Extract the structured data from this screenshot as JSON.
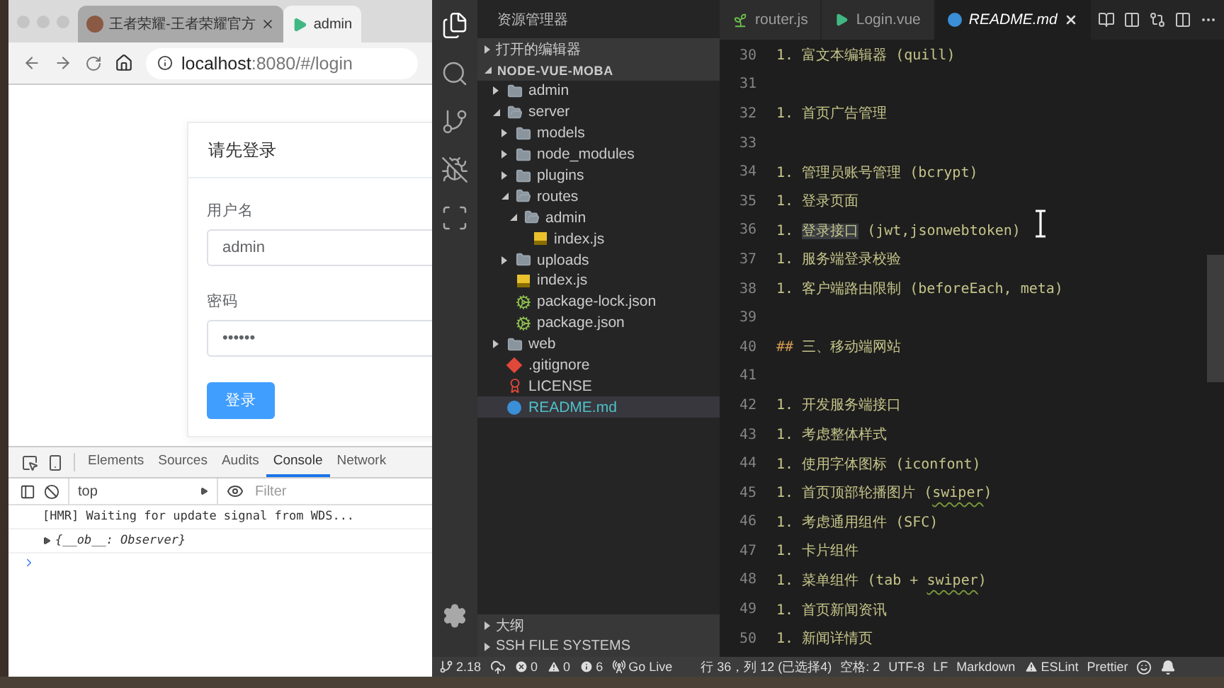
{
  "browser": {
    "tabs": [
      {
        "title": "王者荣耀-王者荣耀官方",
        "kind": "avatar",
        "selected": false
      },
      {
        "title": "admin",
        "kind": "vue",
        "selected": true
      }
    ],
    "address": "**localhost**:8080/#/login",
    "login": {
      "title": "请先登录",
      "fields": [
        {
          "label": "用户名",
          "value": "admin"
        },
        {
          "label": "密码",
          "value": "••••••"
        }
      ],
      "submit": "登录"
    },
    "devtools": {
      "tabs": [
        {
          "label": "Elements",
          "selected": false
        },
        {
          "label": "Sources",
          "selected": false
        },
        {
          "label": "Audits",
          "selected": false
        },
        {
          "label": "Console",
          "selected": true
        },
        {
          "label": "Network",
          "selected": false
        }
      ],
      "context": "top",
      "filter_placeholder": "Filter",
      "console": [
        {
          "kind": "log",
          "text": "[HMR] Waiting for update signal from WDS..."
        },
        {
          "kind": "object",
          "text": "{__ob__: Observer}",
          "expanded": false
        }
      ]
    }
  },
  "vscode": {
    "activity": [
      {
        "kind": "files",
        "selected": true
      },
      {
        "kind": "search",
        "selected": false
      },
      {
        "kind": "source-control",
        "selected": false
      },
      {
        "kind": "debug",
        "selected": false
      },
      {
        "kind": "remote",
        "selected": false
      }
    ],
    "sidebar": {
      "title": "资源管理器",
      "open_editors": {
        "label": "打开的编辑器",
        "expanded": false
      },
      "project": {
        "label": "NODE-VUE-MOBA",
        "expanded": true,
        "tree": [
          {
            "name": "admin",
            "kind": "folder",
            "expanded": false,
            "selected": false
          },
          {
            "name": "server",
            "kind": "folder",
            "expanded": true,
            "selected": false,
            "children": [
              {
                "name": "models",
                "kind": "folder",
                "expanded": false,
                "selected": false
              },
              {
                "name": "node_modules",
                "kind": "folder",
                "expanded": false,
                "selected": false
              },
              {
                "name": "plugins",
                "kind": "folder",
                "expanded": false,
                "selected": false
              },
              {
                "name": "routes",
                "kind": "folder",
                "expanded": true,
                "selected": false,
                "children": [
                  {
                    "name": "admin",
                    "kind": "folder",
                    "expanded": true,
                    "selected": false,
                    "children": [
                      {
                        "name": "index.js",
                        "kind": "js",
                        "selected": false
                      }
                    ]
                  }
                ]
              },
              {
                "name": "uploads",
                "kind": "folder",
                "expanded": false,
                "selected": false
              },
              {
                "name": "index.js",
                "kind": "js",
                "selected": false
              },
              {
                "name": "package-lock.json",
                "kind": "json",
                "selected": false
              },
              {
                "name": "package.json",
                "kind": "json",
                "selected": false
              }
            ]
          },
          {
            "name": "web",
            "kind": "folder",
            "expanded": false,
            "selected": false
          },
          {
            "name": ".gitignore",
            "kind": "git",
            "selected": false
          },
          {
            "name": "LICENSE",
            "kind": "license",
            "selected": false
          },
          {
            "name": "README.md",
            "kind": "md",
            "selected": true
          }
        ]
      },
      "bottom_sections": [
        {
          "label": "大纲",
          "expanded": false
        },
        {
          "label": "SSH FILE SYSTEMS",
          "expanded": false
        }
      ]
    },
    "editor_tabs": [
      {
        "label": "router.js",
        "kind": "router",
        "selected": false,
        "preview": false
      },
      {
        "label": "Login.vue",
        "kind": "vue",
        "selected": false,
        "preview": false
      },
      {
        "label": "README.md",
        "kind": "md",
        "selected": true,
        "preview": true
      }
    ],
    "lines": [
      {
        "number": "30",
        "parts": [
          {
            "kind": "text",
            "text": "1. 富文本编辑器 (quill)"
          }
        ]
      },
      {
        "number": "31"
      },
      {
        "number": "32",
        "parts": [
          {
            "kind": "text",
            "text": "1. 首页广告管理"
          }
        ]
      },
      {
        "number": "33"
      },
      {
        "number": "34",
        "parts": [
          {
            "kind": "text",
            "text": "1. 管理员账号管理 (bcrypt)"
          }
        ]
      },
      {
        "number": "35",
        "parts": [
          {
            "kind": "text",
            "text": "1. 登录页面"
          }
        ]
      },
      {
        "number": "36",
        "parts": [
          {
            "kind": "text",
            "text": "1. "
          },
          {
            "kind": "selection",
            "text": "登录接口"
          },
          {
            "kind": "text",
            "text": " (jwt,jsonwebtoken)"
          }
        ]
      },
      {
        "number": "37",
        "parts": [
          {
            "kind": "text",
            "text": "1. 服务端登录校验"
          }
        ]
      },
      {
        "number": "38",
        "parts": [
          {
            "kind": "text",
            "text": "1. 客户端路由限制 (beforeEach, meta)"
          }
        ]
      },
      {
        "number": "39"
      },
      {
        "number": "40",
        "parts": [
          {
            "kind": "marker",
            "text": "##"
          },
          {
            "kind": "text",
            "text": " 三、移动端网站"
          }
        ]
      },
      {
        "number": "41"
      },
      {
        "number": "42",
        "parts": [
          {
            "kind": "text",
            "text": "1. 开发服务端接口"
          }
        ]
      },
      {
        "number": "43",
        "parts": [
          {
            "kind": "text",
            "text": "1. 考虑整体样式"
          }
        ]
      },
      {
        "number": "44",
        "parts": [
          {
            "kind": "text",
            "text": "1. 使用字体图标 (iconfont)"
          }
        ]
      },
      {
        "number": "45",
        "parts": [
          {
            "kind": "text",
            "text": "1. 首页顶部轮播图片 ("
          },
          {
            "kind": "warning",
            "text": "swiper"
          },
          {
            "kind": "text",
            "text": ")"
          }
        ]
      },
      {
        "number": "46",
        "parts": [
          {
            "kind": "text",
            "text": "1. 考虑通用组件 (SFC)"
          }
        ]
      },
      {
        "number": "47",
        "parts": [
          {
            "kind": "text",
            "text": "1. 卡片组件"
          }
        ]
      },
      {
        "number": "48",
        "parts": [
          {
            "kind": "text",
            "text": "1. 菜单组件 (tab + "
          },
          {
            "kind": "warning",
            "text": "swiper"
          },
          {
            "kind": "text",
            "text": ")"
          }
        ]
      },
      {
        "number": "49",
        "parts": [
          {
            "kind": "text",
            "text": "1. 首页新闻资讯"
          }
        ]
      },
      {
        "number": "50",
        "parts": [
          {
            "kind": "text",
            "text": "1. 新闻详情页"
          }
        ]
      }
    ],
    "status_bar": [
      {
        "kind": "branch",
        "text": "2.18"
      },
      {
        "kind": "sync"
      },
      {
        "kind": "errors",
        "text": "0"
      },
      {
        "kind": "warnings",
        "text": "0"
      },
      {
        "kind": "infos",
        "text": "6"
      },
      {
        "kind": "golive",
        "text": "Go Live"
      },
      {
        "kind": "text",
        "text": "行 36，列 12 (已选择4)"
      },
      {
        "kind": "text",
        "text": "空格: 2"
      },
      {
        "kind": "text",
        "text": "UTF-8"
      },
      {
        "kind": "text",
        "text": "LF"
      },
      {
        "kind": "text",
        "text": "Markdown"
      },
      {
        "kind": "eslint",
        "text": "ESLint"
      },
      {
        "kind": "text",
        "text": "Prettier"
      },
      {
        "kind": "feedback"
      },
      {
        "kind": "bell"
      }
    ]
  }
}
